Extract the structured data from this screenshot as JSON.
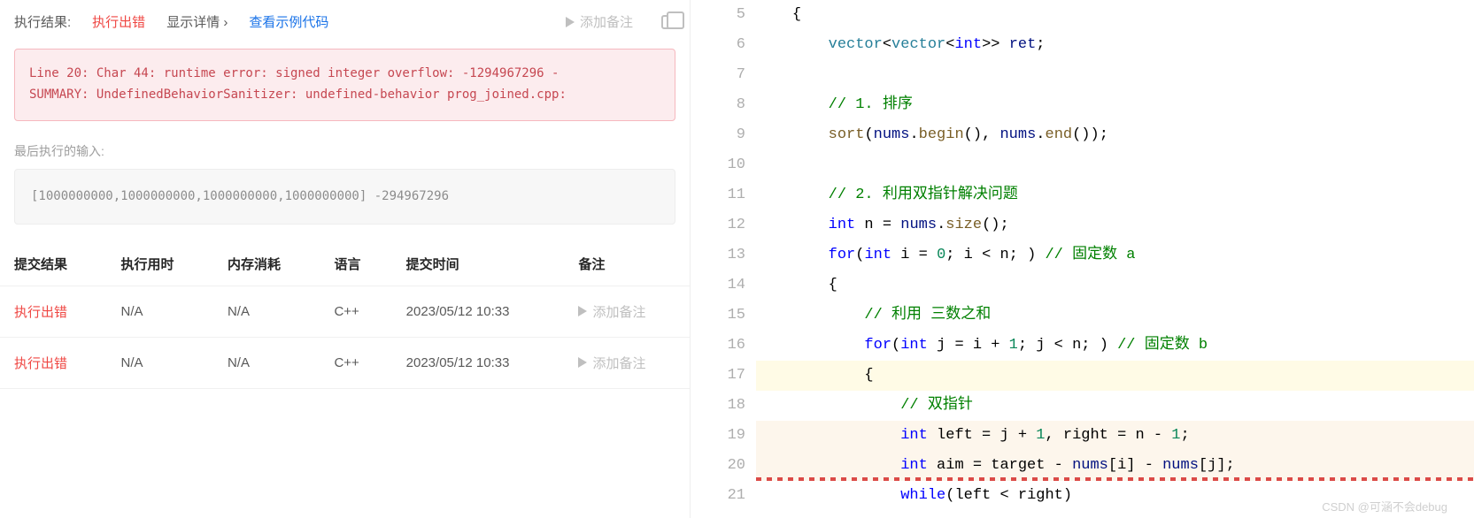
{
  "tabs": {
    "result_lbl": "执行结果:",
    "error": "执行出错",
    "detail": "显示详情 ›",
    "sample": "查看示例代码",
    "add_note": "添加备注"
  },
  "error_msg": "Line 20: Char 44: runtime error: signed integer overflow: -1294967296 -\nSUMMARY: UndefinedBehaviorSanitizer: undefined-behavior prog_joined.cpp:",
  "last_input_lbl": "最后执行的输入:",
  "last_input": "[1000000000,1000000000,1000000000,1000000000]\n-294967296",
  "headers": [
    "提交结果",
    "执行用时",
    "内存消耗",
    "语言",
    "提交时间",
    "备注"
  ],
  "rows": [
    {
      "result": "执行出错",
      "time": "N/A",
      "mem": "N/A",
      "lang": "C++",
      "ts": "2023/05/12 10:33",
      "note": "添加备注"
    },
    {
      "result": "执行出错",
      "time": "N/A",
      "mem": "N/A",
      "lang": "C++",
      "ts": "2023/05/12 10:33",
      "note": "添加备注"
    }
  ],
  "code": {
    "start": 5,
    "lines": [
      {
        "t": [
          "    ",
          [
            "{",
            "punc"
          ]
        ]
      },
      {
        "t": [
          "        ",
          [
            "vector",
            "type"
          ],
          [
            "<",
            "punc"
          ],
          [
            "vector",
            "type"
          ],
          [
            "<",
            "punc"
          ],
          [
            "int",
            "kw"
          ],
          [
            ">> ",
            "punc"
          ],
          [
            "ret",
            "ident"
          ],
          [
            ";",
            "punc"
          ]
        ]
      },
      {
        "t": [
          ""
        ]
      },
      {
        "t": [
          "        ",
          [
            "// 1. 排序",
            "comm"
          ]
        ]
      },
      {
        "t": [
          "        ",
          [
            "sort",
            "func"
          ],
          [
            "(",
            "punc"
          ],
          [
            "nums",
            "ident"
          ],
          [
            ".",
            "punc"
          ],
          [
            "begin",
            "func"
          ],
          [
            "(), ",
            "punc"
          ],
          [
            "nums",
            "ident"
          ],
          [
            ".",
            "punc"
          ],
          [
            "end",
            "func"
          ],
          [
            "());",
            "punc"
          ]
        ]
      },
      {
        "t": [
          ""
        ]
      },
      {
        "t": [
          "        ",
          [
            "// 2. 利用双指针解决问题",
            "comm"
          ]
        ]
      },
      {
        "t": [
          "        ",
          [
            "int",
            "kw"
          ],
          [
            " n = ",
            "punc"
          ],
          [
            "nums",
            "ident"
          ],
          [
            ".",
            "punc"
          ],
          [
            "size",
            "func"
          ],
          [
            "();",
            "punc"
          ]
        ]
      },
      {
        "t": [
          "        ",
          [
            "for",
            "kw"
          ],
          [
            "(",
            "punc"
          ],
          [
            "int",
            "kw"
          ],
          [
            " i = ",
            "punc"
          ],
          [
            "0",
            "num"
          ],
          [
            "; i < n; ) ",
            "punc"
          ],
          [
            "// 固定数 a",
            "comm"
          ]
        ]
      },
      {
        "t": [
          "        ",
          [
            "{",
            "punc"
          ]
        ]
      },
      {
        "t": [
          "            ",
          [
            "// 利用 三数之和",
            "comm"
          ]
        ]
      },
      {
        "t": [
          "            ",
          [
            "for",
            "kw"
          ],
          [
            "(",
            "punc"
          ],
          [
            "int",
            "kw"
          ],
          [
            " j = i + ",
            "punc"
          ],
          [
            "1",
            "num"
          ],
          [
            "; j < n; ) ",
            "punc"
          ],
          [
            "// 固定数 b",
            "comm"
          ]
        ]
      },
      {
        "t": [
          "            ",
          [
            "{",
            "punc"
          ]
        ],
        "hl": "hl"
      },
      {
        "t": [
          "                ",
          [
            "// 双指针",
            "comm"
          ]
        ]
      },
      {
        "t": [
          "                ",
          [
            "int",
            "kw"
          ],
          [
            " left = j + ",
            "punc"
          ],
          [
            "1",
            "num"
          ],
          [
            ", right = n - ",
            "punc"
          ],
          [
            "1",
            "num"
          ],
          [
            ";",
            "punc"
          ]
        ],
        "hl": "hl2"
      },
      {
        "t": [
          "                ",
          [
            "int",
            "kw"
          ],
          [
            " aim = target - ",
            "punc"
          ],
          [
            "nums",
            "ident"
          ],
          [
            "[i] - ",
            "punc"
          ],
          [
            "nums",
            "ident"
          ],
          [
            "[j];",
            "punc"
          ]
        ],
        "hl": "hl2",
        "wavy": true
      },
      {
        "t": [
          "                ",
          [
            "while",
            "kw"
          ],
          [
            "(left < right)",
            "punc"
          ]
        ]
      }
    ]
  },
  "watermark": "CSDN @可涵不会debug"
}
